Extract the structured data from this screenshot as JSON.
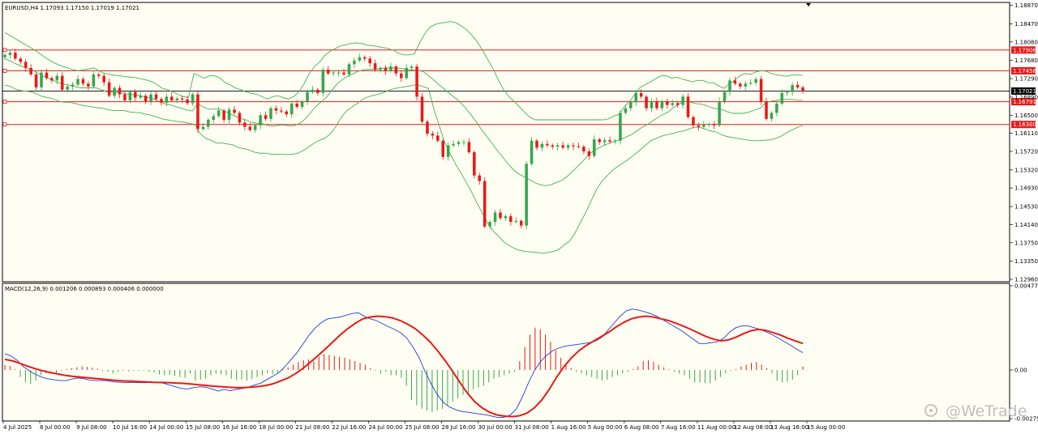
{
  "chart_data": [
    {
      "type": "candlestick",
      "symbol_header": "EURUSD,H4  1.17093 1.17150 1.17019 1.17021",
      "ylim": [
        1.1296,
        1.1888
      ],
      "y_ticks": [
        "1.18870",
        "1.18470",
        "1.18080",
        "1.17680",
        "1.17290",
        "1.16890",
        "1.16500",
        "1.16110",
        "1.15720",
        "1.15320",
        "1.14930",
        "1.14530",
        "1.14140",
        "1.13750",
        "1.13350",
        "1.12960"
      ],
      "x_ticks": [
        "4 Jul 2025",
        "8 Jul 00:00",
        "9 Jul 08:00",
        "10 Jul 16:00",
        "14 Jul 00:00",
        "15 Jul 08:00",
        "16 Jul 16:00",
        "18 Jul 00:00",
        "21 Jul 08:00",
        "22 Jul 16:00",
        "24 Jul 00:00",
        "25 Jul 08:00",
        "28 Jul 16:00",
        "30 Jul 00:00",
        "31 Jul 08:00",
        "1 Aug 16:00",
        "5 Aug 00:00",
        "6 Aug 08:00",
        "7 Aug 16:00",
        "11 Aug 00:00",
        "12 Aug 08:00",
        "13 Aug 16:00",
        "15 Aug 00:00"
      ],
      "horizontal_levels": [
        {
          "value": 1.17906,
          "label": "1.17906",
          "color": "#e81919"
        },
        {
          "value": 1.17458,
          "label": "1.17458",
          "color": "#e81919"
        },
        {
          "value": 1.16791,
          "label": "1.16791",
          "color": "#e81919"
        },
        {
          "value": 1.163,
          "label": "1.16300",
          "color": "#e81919"
        }
      ],
      "current_price": {
        "value": 1.17021,
        "label": "1.17021",
        "color": "#000000"
      },
      "bull_color": "#36a64f",
      "bear_color": "#e81919",
      "band_color": "#41b358",
      "closes": [
        1.178,
        1.1785,
        1.1772,
        1.1765,
        1.1752,
        1.1738,
        1.171,
        1.1742,
        1.173,
        1.1725,
        1.1735,
        1.1705,
        1.1712,
        1.1716,
        1.1728,
        1.1718,
        1.1712,
        1.1738,
        1.1735,
        1.1721,
        1.1692,
        1.1709,
        1.1695,
        1.1682,
        1.17,
        1.1688,
        1.1692,
        1.168,
        1.1695,
        1.1685,
        1.1677,
        1.169,
        1.1682,
        1.1686,
        1.1684,
        1.1676,
        1.1695,
        1.162,
        1.1625,
        1.164,
        1.1648,
        1.166,
        1.164,
        1.1662,
        1.1655,
        1.1634,
        1.1625,
        1.1618,
        1.1628,
        1.165,
        1.1642,
        1.1665,
        1.166,
        1.1658,
        1.1652,
        1.1675,
        1.1668,
        1.168,
        1.17,
        1.1705,
        1.1698,
        1.1748,
        1.174,
        1.1742,
        1.1742,
        1.1738,
        1.176,
        1.1768,
        1.1775,
        1.1772,
        1.1762,
        1.1748,
        1.1752,
        1.1745,
        1.1755,
        1.174,
        1.173,
        1.1752,
        1.1755,
        1.169,
        1.1636,
        1.161,
        1.1606,
        1.1595,
        1.156,
        1.1585,
        1.1588,
        1.1592,
        1.1592,
        1.157,
        1.152,
        1.1508,
        1.141,
        1.142,
        1.144,
        1.1428,
        1.1432,
        1.142,
        1.1422,
        1.1412,
        1.1545,
        1.1595,
        1.158,
        1.1588,
        1.1585,
        1.1582,
        1.1585,
        1.158,
        1.1585,
        1.1583,
        1.1582,
        1.1572,
        1.1562,
        1.1598,
        1.1592,
        1.1596,
        1.1593,
        1.1595,
        1.1655,
        1.1665,
        1.1678,
        1.1698,
        1.169,
        1.1665,
        1.168,
        1.1665,
        1.168,
        1.1672,
        1.1676,
        1.1672,
        1.169,
        1.1646,
        1.1628,
        1.1625,
        1.163,
        1.1631,
        1.1628,
        1.168,
        1.17,
        1.1725,
        1.1718,
        1.1712,
        1.1718,
        1.172,
        1.1728,
        1.168,
        1.1642,
        1.1655,
        1.1675,
        1.1698,
        1.17,
        1.1715,
        1.171,
        1.1702
      ],
      "bollinger_upper": [
        1.1828,
        1.1822,
        1.1815,
        1.1808,
        1.1802,
        1.1795,
        1.1788,
        1.178,
        1.1772,
        1.1765,
        1.176,
        1.1755,
        1.1752,
        1.1748,
        1.1746,
        1.1748,
        1.175,
        1.1752,
        1.1745,
        1.174,
        1.1738,
        1.1736,
        1.1735,
        1.1733,
        1.1732,
        1.1731,
        1.1728,
        1.1726,
        1.1722,
        1.1716,
        1.1708,
        1.1705,
        1.17,
        1.1695,
        1.169,
        1.1688,
        1.174,
        1.1735,
        1.173,
        1.1735,
        1.1735,
        1.173,
        1.172,
        1.1715,
        1.1708,
        1.1705,
        1.17,
        1.1697,
        1.1695,
        1.169,
        1.1685,
        1.169,
        1.1692,
        1.1688,
        1.1685,
        1.169,
        1.17,
        1.1718,
        1.174,
        1.1755,
        1.1765,
        1.178,
        1.1788,
        1.1794,
        1.18,
        1.1802,
        1.1805,
        1.1806,
        1.1805,
        1.1801,
        1.18,
        1.1798,
        1.1796,
        1.1794,
        1.179,
        1.1784,
        1.178,
        1.178,
        1.1782,
        1.1806,
        1.1826,
        1.184,
        1.1846,
        1.1849,
        1.185,
        1.1852,
        1.1849,
        1.1842,
        1.1834,
        1.1822,
        1.1808,
        1.179,
        1.177,
        1.175,
        1.1726,
        1.1705,
        1.169,
        1.168,
        1.1668,
        1.1656,
        1.1646,
        1.164,
        1.164,
        1.164,
        1.164,
        1.164,
        1.164,
        1.164,
        1.164,
        1.164,
        1.164,
        1.164,
        1.164,
        1.164,
        1.164,
        1.1642,
        1.1648,
        1.1652,
        1.1668,
        1.168,
        1.1695,
        1.171,
        1.1716,
        1.1722,
        1.1729,
        1.1735,
        1.1735,
        1.173,
        1.1732,
        1.1728,
        1.1725,
        1.1722,
        1.1725,
        1.1725,
        1.172,
        1.172,
        1.1713,
        1.1708,
        1.1718,
        1.1725,
        1.1735,
        1.174,
        1.1738,
        1.1743,
        1.1746,
        1.1745,
        1.174,
        1.1737,
        1.1735,
        1.1734,
        1.1737,
        1.1737,
        1.1736
      ],
      "bollinger_lower": [
        1.1715,
        1.1712,
        1.1706,
        1.1703,
        1.1702,
        1.17,
        1.1695,
        1.169,
        1.1688,
        1.1685,
        1.168,
        1.1678,
        1.1678,
        1.1675,
        1.1672,
        1.167,
        1.1668,
        1.1666,
        1.1665,
        1.1662,
        1.166,
        1.166,
        1.166,
        1.1657,
        1.1656,
        1.1655,
        1.1652,
        1.165,
        1.1646,
        1.1642,
        1.164,
        1.1638,
        1.1636,
        1.1635,
        1.1632,
        1.163,
        1.161,
        1.16,
        1.1596,
        1.159,
        1.159,
        1.1588,
        1.1586,
        1.158,
        1.1578,
        1.1575,
        1.157,
        1.1568,
        1.1568,
        1.1566,
        1.1566,
        1.1566,
        1.1565,
        1.1566,
        1.1568,
        1.1574,
        1.1582,
        1.159,
        1.1596,
        1.1601,
        1.161,
        1.1626,
        1.1646,
        1.166,
        1.1668,
        1.1676,
        1.1685,
        1.169,
        1.1693,
        1.1696,
        1.17,
        1.1705,
        1.1708,
        1.171,
        1.1712,
        1.1714,
        1.1716,
        1.1712,
        1.1708,
        1.1665,
        1.1628,
        1.1592,
        1.1568,
        1.1545,
        1.1526,
        1.1505,
        1.1484,
        1.146,
        1.1438,
        1.1416,
        1.14,
        1.1388,
        1.1376,
        1.1368,
        1.1362,
        1.1358,
        1.1356,
        1.1355,
        1.1354,
        1.1352,
        1.1354,
        1.1356,
        1.136,
        1.137,
        1.1378,
        1.1395,
        1.1418,
        1.144,
        1.1465,
        1.149,
        1.1508,
        1.152,
        1.1532,
        1.154,
        1.1548,
        1.1556,
        1.1565,
        1.1575,
        1.1585,
        1.1595,
        1.16,
        1.1605,
        1.1608,
        1.161,
        1.1614,
        1.1616,
        1.162,
        1.1624,
        1.1624,
        1.162,
        1.1616,
        1.1614,
        1.1608,
        1.1604,
        1.1602,
        1.16,
        1.1598,
        1.1596,
        1.1595,
        1.1595,
        1.1596,
        1.1597,
        1.16,
        1.1605,
        1.1612,
        1.1618,
        1.1624,
        1.1628
      ],
      "bollinger_middle": [
        1.1772,
        1.1767,
        1.1761,
        1.1756,
        1.1752,
        1.1748,
        1.1742,
        1.1735,
        1.173,
        1.1725,
        1.172,
        1.1717,
        1.1715,
        1.1712,
        1.1709,
        1.1709,
        1.1709,
        1.1709,
        1.1705,
        1.1701,
        1.1699,
        1.1698,
        1.1698,
        1.1695,
        1.1694,
        1.1693,
        1.169,
        1.1688,
        1.1684,
        1.1679,
        1.1674,
        1.1672,
        1.1668,
        1.1665,
        1.1661,
        1.1659,
        1.1675,
        1.1668,
        1.1663,
        1.1663,
        1.1663,
        1.1659,
        1.1653,
        1.1648,
        1.1643,
        1.164,
        1.1635,
        1.1633,
        1.1632,
        1.1628,
        1.1626,
        1.1628,
        1.1629,
        1.1627,
        1.1627,
        1.1632,
        1.1641,
        1.1654,
        1.1668,
        1.1678,
        1.1688,
        1.1703,
        1.1717,
        1.1727,
        1.1734,
        1.1739,
        1.1745,
        1.1748,
        1.1749,
        1.1749,
        1.175,
        1.1752,
        1.1752,
        1.1752,
        1.1751,
        1.1749,
        1.1748,
        1.1746,
        1.1745,
        1.1736,
        1.1727,
        1.1716,
        1.1707,
        1.1697,
        1.1688,
        1.1678,
        1.1666,
        1.1651,
        1.1636,
        1.1619,
        1.1604,
        1.1589,
        1.1573,
        1.1559,
        1.1544,
        1.1532,
        1.1523,
        1.1517,
        1.1511,
        1.1504,
        1.15,
        1.1498,
        1.15,
        1.1505,
        1.1509,
        1.1518,
        1.1529,
        1.154,
        1.1552,
        1.1565,
        1.1574,
        1.158,
        1.1586,
        1.159,
        1.1594,
        1.1598,
        1.1603,
        1.1608,
        1.1616,
        1.1624,
        1.163,
        1.1638,
        1.1646,
        1.1652,
        1.1658,
        1.1668,
        1.1675,
        1.168,
        1.1678,
        1.1675,
        1.1674,
        1.1671,
        1.1666,
        1.1664,
        1.1662,
        1.1657,
        1.1654,
        1.1654,
        1.1654,
        1.1657,
        1.1661,
        1.1665,
        1.1676,
        1.168,
        1.1682,
        1.1684,
        1.1684,
        1.1684,
        1.1682,
        1.1682
      ]
    },
    {
      "type": "macd",
      "header": "MACD(12,26,9) 0.001206 0.000893 0.000406 0.000000",
      "ylim": [
        -0.002757,
        0.004774
      ],
      "y_ticks": [
        "0.004774",
        "0.00",
        "-0.002757"
      ],
      "histogram_up_color": "#e81919",
      "histogram_down_color": "#36a64f",
      "macd_line_color": "#1f3fd6",
      "signal_line_color": "#e81919",
      "histogram": [
        0.00028,
        0.00022,
        5e-05,
        -0.0004,
        -0.0007,
        -0.0008,
        -0.0006,
        -0.0003,
        -0.0002,
        -5e-05,
        -0.0002,
        -5e-05,
        5e-05,
        0.0001,
        0.00015,
        0.0002,
        0.00018,
        0.00012,
        8e-05,
        -5e-05,
        -0.0001,
        -0.0002,
        -0.0001,
        -5e-05,
        -8e-05,
        -5e-05,
        -5e-05,
        -4e-05,
        -0.0001,
        -0.00015,
        -0.00025,
        -0.0003,
        -0.00028,
        -0.00035,
        -0.0004,
        -0.00045,
        -0.0002,
        -0.0006,
        -0.00055,
        -0.0005,
        -0.0003,
        -0.0002,
        -0.00025,
        -0.0003,
        -0.0005,
        -0.00058,
        -0.00055,
        -0.0006,
        -0.00052,
        -0.0004,
        -0.0003,
        -0.0002,
        -0.00025,
        -0.00015,
        5e-05,
        0.00015,
        0.0003,
        0.00045,
        0.00055,
        0.0006,
        0.0005,
        0.00075,
        0.0009,
        0.00085,
        0.0008,
        0.00075,
        0.0007,
        0.0006,
        0.0005,
        0.0004,
        0.0003,
        0.0001,
        -5e-05,
        -0.0002,
        -0.0001,
        -0.0003,
        -0.0003,
        -0.00045,
        -0.0009,
        -0.0017,
        -0.002,
        -0.0022,
        -0.0023,
        -0.0024,
        -0.0023,
        -0.0022,
        -0.002,
        -0.0018,
        -0.0016,
        -0.0014,
        -0.0013,
        -0.0011,
        -0.001,
        -0.0009,
        -0.0007,
        -0.0005,
        -0.0004,
        -0.0003,
        -0.0002,
        -0.0001,
        0.0005,
        0.0013,
        0.002,
        0.0024,
        0.0023,
        0.002,
        0.0016,
        0.0011,
        0.0007,
        0.0004,
        0.0001,
        -0.0001,
        -0.0002,
        -0.0003,
        -0.0004,
        -0.0005,
        -0.0006,
        -0.00055,
        -0.0004,
        -0.0003,
        -0.0002,
        -0.0001,
        5e-05,
        0.0002,
        0.0005,
        0.00055,
        0.00045,
        0.0003,
        0.00015,
        5e-05,
        -0.0001,
        -0.0002,
        -0.0003,
        -0.0005,
        -0.0007,
        -0.0007,
        -0.00075,
        -0.00075,
        -0.0006,
        -0.0004,
        -0.0002,
        -5e-05,
        5e-05,
        0.0002,
        0.0003,
        0.0004,
        0.00045,
        0.0003,
        0.0001,
        -0.0002,
        -0.0006,
        -0.0007,
        -0.00065,
        -0.00055,
        -0.0003,
        0.0002
      ],
      "macd_line": [
        0.00092,
        0.0008,
        0.00055,
        0.0002,
        -5e-05,
        -0.00025,
        -0.0004,
        -0.0005,
        -0.00055,
        -0.0006,
        -0.0006,
        -0.00052,
        -0.00045,
        -0.0005,
        -0.00058,
        -0.0006,
        -0.0006,
        -0.00062,
        -0.00068,
        -0.0007,
        -0.00072,
        -0.0007,
        -0.00072,
        -0.00072,
        -0.0007,
        -0.00068,
        -0.00075,
        -0.00085,
        -0.00095,
        -0.00105,
        -0.00108,
        -0.001,
        -0.00095,
        -0.00098,
        -0.00108,
        -0.0012,
        -0.0011,
        -0.00118,
        -0.0011,
        -0.00105,
        -0.00098,
        -0.00085,
        -0.00075,
        -0.00055,
        -0.00035,
        -0.00015,
        0.0002,
        0.0006,
        0.001,
        0.0015,
        0.002,
        0.0024,
        0.0027,
        0.0029,
        0.00295,
        0.003,
        0.0031,
        0.0032,
        0.00325,
        0.00305,
        0.0029,
        0.0028,
        0.00262,
        0.00245,
        0.0023,
        0.0021,
        0.0018,
        0.0013,
        0.0007,
        -0.0001,
        -0.0008,
        -0.0014,
        -0.00185,
        -0.0021,
        -0.00225,
        -0.00235,
        -0.0024,
        -0.00245,
        -0.0025,
        -0.00255,
        -0.00262,
        -0.0027,
        -0.00268,
        -0.00255,
        -0.0022,
        -0.0015,
        -0.0007,
        0.0,
        0.0005,
        0.00085,
        0.0011,
        0.00125,
        0.00135,
        0.0014,
        0.00145,
        0.0015,
        0.00155,
        0.00165,
        0.00185,
        0.00225,
        0.00265,
        0.00305,
        0.00335,
        0.00345,
        0.0034,
        0.0033,
        0.0032,
        0.00305,
        0.00285,
        0.00265,
        0.00245,
        0.00225,
        0.002,
        0.00175,
        0.0015,
        0.0015,
        0.00155,
        0.0016,
        0.0018,
        0.00215,
        0.0024,
        0.0025,
        0.0025,
        0.0024,
        0.0023,
        0.00215,
        0.002,
        0.0018,
        0.0016,
        0.0014,
        0.00118,
        0.00098
      ],
      "signal_line": [
        0.0006,
        0.00052,
        0.00038,
        0.00022,
        8e-05,
        -4e-05,
        -0.00014,
        -0.00022,
        -0.0003,
        -0.00036,
        -0.0004,
        -0.00044,
        -0.00048,
        -0.00052,
        -0.00056,
        -0.0006,
        -0.00062,
        -0.00064,
        -0.00066,
        -0.00068,
        -0.0007,
        -0.00071,
        -0.00072,
        -0.00074,
        -0.00076,
        -0.0008,
        -0.00084,
        -0.00088,
        -0.00092,
        -0.00095,
        -0.00098,
        -0.001,
        -0.001,
        -0.00098,
        -0.00094,
        -0.00088,
        -0.00078,
        -0.00062,
        -0.00045,
        -0.0002,
        0.0001,
        0.00045,
        0.00082,
        0.0012,
        0.0016,
        0.002,
        0.00235,
        0.00265,
        0.0029,
        0.003,
        0.00305,
        0.00302,
        0.00295,
        0.0028,
        0.0026,
        0.00235,
        0.002,
        0.0016,
        0.0011,
        0.00055,
        -5e-05,
        -0.0007,
        -0.0013,
        -0.0018,
        -0.00215,
        -0.0024,
        -0.00255,
        -0.00262,
        -0.00265,
        -0.0026,
        -0.00245,
        -0.00215,
        -0.0017,
        -0.0011,
        -0.0004,
        0.0002,
        0.0007,
        0.0011,
        0.0014,
        0.00165,
        0.0019,
        0.00215,
        0.00245,
        0.0027,
        0.0029,
        0.003,
        0.00305,
        0.003,
        0.0029,
        0.0028,
        0.00265,
        0.00248,
        0.0023,
        0.0021,
        0.0019,
        0.00175,
        0.00165,
        0.0017,
        0.00185,
        0.00205,
        0.00222,
        0.0023,
        0.00225,
        0.00212,
        0.00198,
        0.0018,
        0.00165,
        0.0015
      ]
    }
  ],
  "watermark": "@WeTrade",
  "colors": {
    "background": "#ffffff",
    "plot_background": "#fffef2",
    "grid": "#000000",
    "text": "#000000"
  }
}
